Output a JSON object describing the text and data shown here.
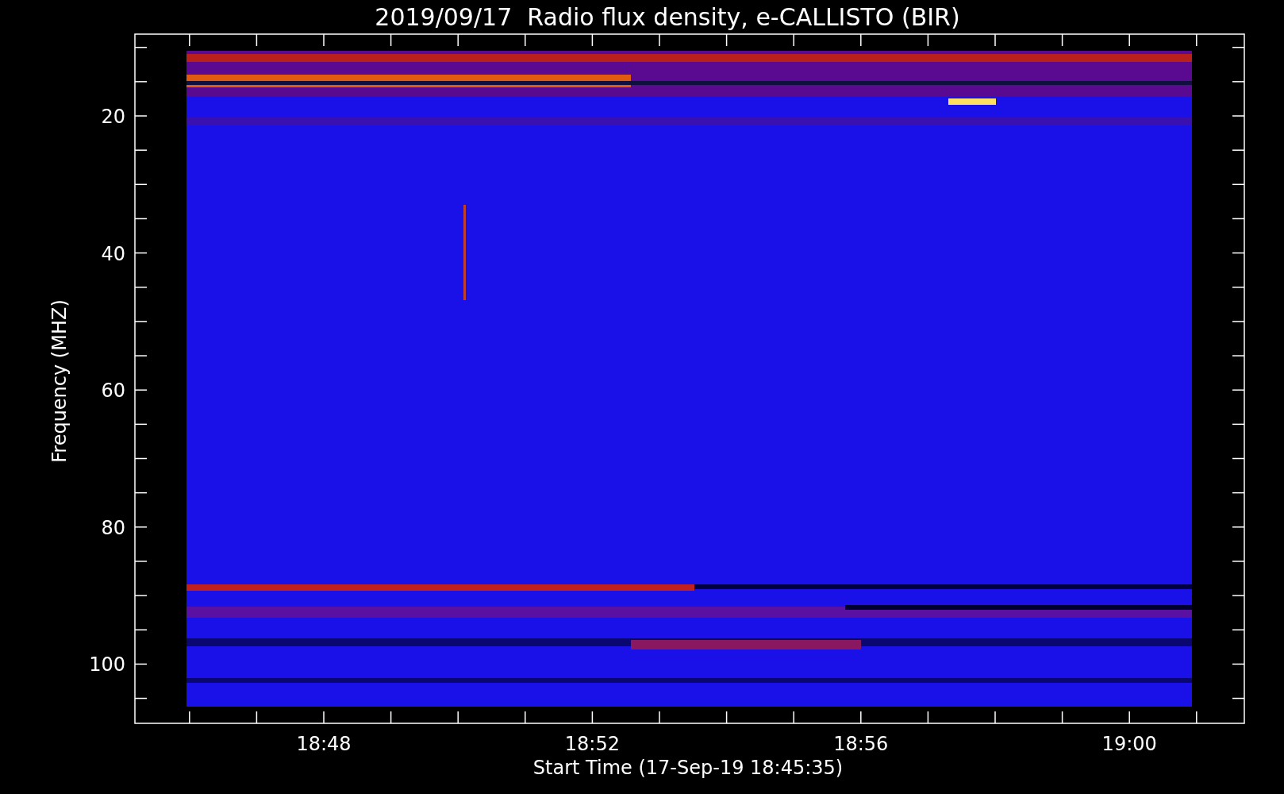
{
  "title": "2019/09/17  Radio flux density, e-CALLISTO (BIR)",
  "y_axis": {
    "label": "Frequency (MHZ)",
    "ticks": [
      "20",
      "40",
      "60",
      "80",
      "100"
    ]
  },
  "x_axis": {
    "label": "Start Time (17-Sep-19 18:45:35)",
    "ticks": [
      "18:48",
      "18:52",
      "18:56",
      "19:00"
    ]
  }
}
